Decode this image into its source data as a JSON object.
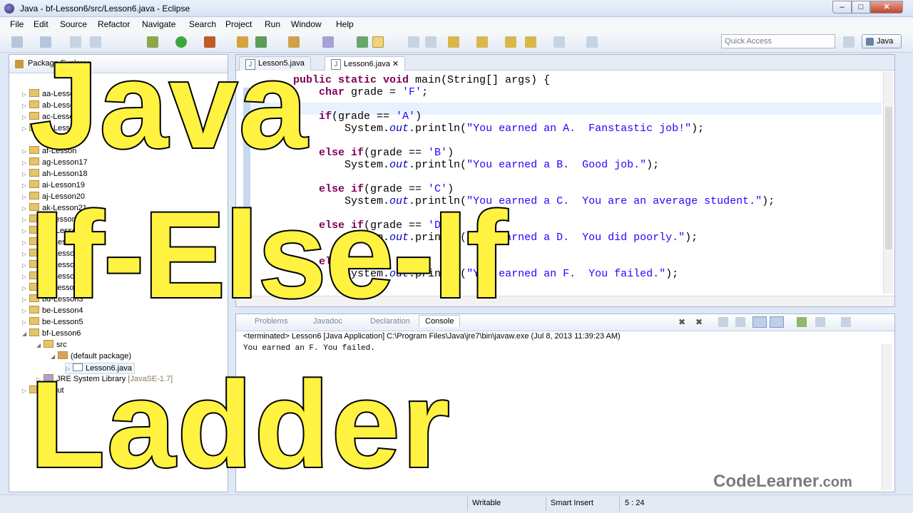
{
  "window": {
    "title": "Java - bf-Lesson6/src/Lesson6.java - Eclipse"
  },
  "menu": [
    "File",
    "Edit",
    "Source",
    "Refactor",
    "Navigate",
    "Search",
    "Project",
    "Run",
    "Window",
    "Help"
  ],
  "toolbar": {
    "quick_access_placeholder": "Quick Access",
    "perspective_label": "Java"
  },
  "package_explorer": {
    "title": "Package Explorer",
    "items": [
      {
        "label": "aa-Lesson",
        "depth": 0
      },
      {
        "label": "ab-Lesson",
        "depth": 0
      },
      {
        "label": "ac-Lesson",
        "depth": 0
      },
      {
        "label": "ad-Lesson",
        "depth": 0
      },
      {
        "label": "af-Lesson",
        "depth": 0
      },
      {
        "label": "ag-Lesson17",
        "depth": 0
      },
      {
        "label": "ah-Lesson18",
        "depth": 0
      },
      {
        "label": "ai-Lesson19",
        "depth": 0
      },
      {
        "label": "aj-Lesson20",
        "depth": 0
      },
      {
        "label": "ak-Lesson21",
        "depth": 0
      },
      {
        "label": "al-Lesson22",
        "depth": 0
      },
      {
        "label": "am-Lesson2",
        "depth": 0
      },
      {
        "label": "an-Lesson2",
        "depth": 0
      },
      {
        "label": "ao-Lesson2",
        "depth": 0
      },
      {
        "label": "ap-Lesson2",
        "depth": 0
      },
      {
        "label": "bb-Lesson1",
        "depth": 0
      },
      {
        "label": "bc-Lesson2",
        "depth": 0
      },
      {
        "label": "bd-Lesson3",
        "depth": 0
      },
      {
        "label": "be-Lesson4",
        "depth": 0
      },
      {
        "label": "be-Lesson5",
        "depth": 0
      },
      {
        "label": "bf-Lesson6",
        "depth": 0
      },
      {
        "label": "src",
        "depth": 1
      },
      {
        "label": "(default package)",
        "depth": 2
      },
      {
        "label": "Lesson6.java",
        "depth": 3
      },
      {
        "label": "JRE System Library",
        "suffix": "[JavaSE-1.7]",
        "depth": 1
      },
      {
        "label": "output",
        "depth": 0
      }
    ]
  },
  "editor": {
    "tabs": [
      {
        "label": "Lesson5.java",
        "active": false
      },
      {
        "label": "Lesson6.java",
        "active": true
      }
    ],
    "code_lines": [
      "public static void main(String[] args) {",
      "    char grade = 'F';",
      "",
      "    if(grade == 'A')",
      "        System.out.println(\"You earned an A.  Fanstastic job!\");",
      "",
      "    else if(grade == 'B')",
      "        System.out.println(\"You earned a B.  Good job.\");",
      "",
      "    else if(grade == 'C')",
      "        System.out.println(\"You earned a C.  You are an average student.\");",
      "",
      "    else if(grade == 'D')",
      "        System.out.println(\"You earned a D.  You did poorly.\");",
      "",
      "    else",
      "        System.out.println(\"You earned an F.  You failed.\");"
    ]
  },
  "console": {
    "tabs": [
      "Problems",
      "Javadoc",
      "Declaration",
      "Console"
    ],
    "active_tab": "Console",
    "status": "<terminated> Lesson6 [Java Application] C:\\Program Files\\Java\\jre7\\bin\\javaw.exe (Jul 8, 2013 11:39:23 AM)",
    "output": "You earned an F.  You failed."
  },
  "statusbar": {
    "mode": "Writable",
    "insert": "Smart Insert",
    "position": "5 : 24"
  },
  "overlay": {
    "line1": "Java",
    "line2": "If-Else-If",
    "line3": "Ladder"
  },
  "watermark": {
    "brand": "CodeLearner",
    "domain": ".com"
  },
  "colors": {
    "overlay_fill": "#fff240",
    "keyword": "#7f0055",
    "string": "#2a00ff",
    "field": "#0000c0"
  }
}
